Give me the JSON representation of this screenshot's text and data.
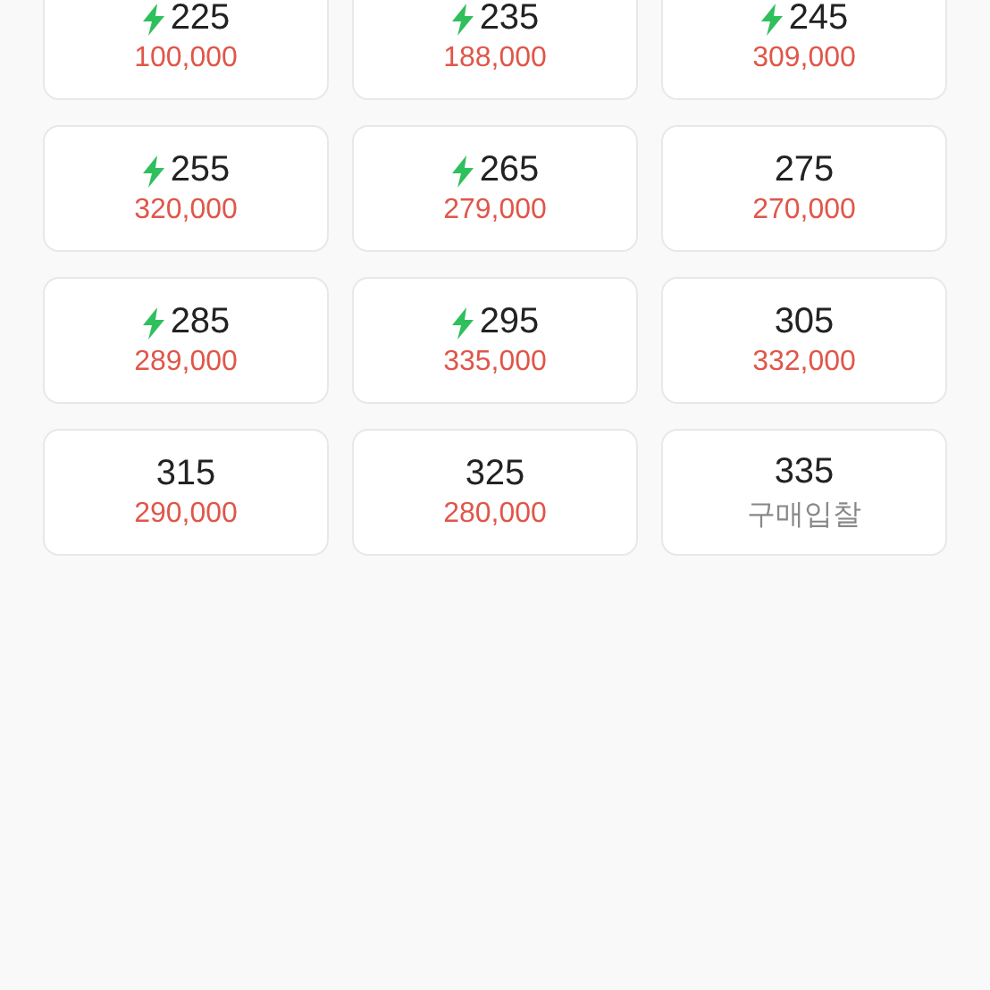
{
  "sizes": [
    {
      "size": "225",
      "express": true,
      "price": "100,000",
      "kind": "price"
    },
    {
      "size": "235",
      "express": true,
      "price": "188,000",
      "kind": "price"
    },
    {
      "size": "245",
      "express": true,
      "price": "309,000",
      "kind": "price"
    },
    {
      "size": "255",
      "express": true,
      "price": "320,000",
      "kind": "price"
    },
    {
      "size": "265",
      "express": true,
      "price": "279,000",
      "kind": "price"
    },
    {
      "size": "275",
      "express": false,
      "price": "270,000",
      "kind": "price"
    },
    {
      "size": "285",
      "express": true,
      "price": "289,000",
      "kind": "price"
    },
    {
      "size": "295",
      "express": true,
      "price": "335,000",
      "kind": "price"
    },
    {
      "size": "305",
      "express": false,
      "price": "332,000",
      "kind": "price"
    },
    {
      "size": "315",
      "express": false,
      "price": "290,000",
      "kind": "price"
    },
    {
      "size": "325",
      "express": false,
      "price": "280,000",
      "kind": "price"
    },
    {
      "size": "335",
      "express": false,
      "price": "구매입찰",
      "kind": "bid"
    }
  ]
}
